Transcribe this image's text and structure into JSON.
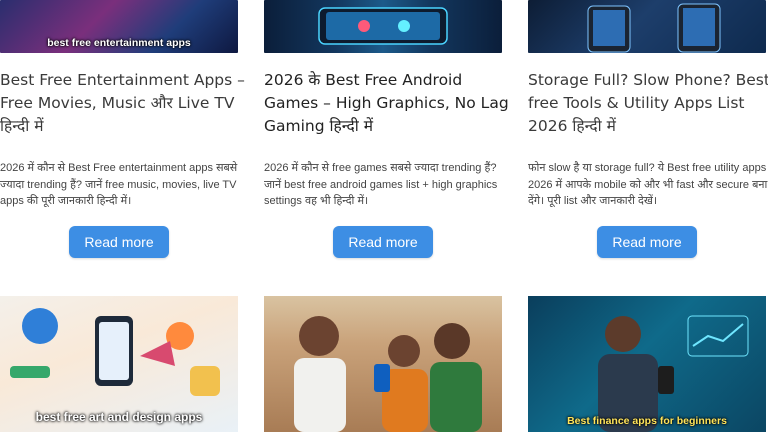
{
  "cards": [
    {
      "image_caption": "best free entertainment apps",
      "title": "Best Free Entertainment Apps – Free Movies, Music और Live TV हिन्दी में",
      "excerpt": "2026 में कौन से Best Free entertainment apps सबसे ज्यादा trending हैं? जानें free music, movies, live TV apps की पूरी जानकारी हिन्दी में।",
      "button": "Read more"
    },
    {
      "image_caption": "",
      "title": "2026 के Best Free Android Games – High Graphics, No Lag Gaming हिन्दी में",
      "excerpt": "2026 में कौन से free games सबसे ज्यादा trending हैं? जानें best free android games list + high graphics settings वह भी हिन्दी में।",
      "button": "Read more"
    },
    {
      "image_caption": "",
      "title": "Storage Full? Slow Phone? Best free Tools & Utility Apps List 2026 हिन्दी में",
      "excerpt": "फोन slow है या storage full? ये Best free utility apps 2026 में आपके mobile को और भी fast और secure बना देंगे। पूरी list और जानकारी देखें।",
      "button": "Read more"
    }
  ],
  "bottom_cards": [
    {
      "image_caption": "best free art and design apps"
    },
    {
      "image_caption": ""
    },
    {
      "image_caption": "Best finance apps for beginners"
    }
  ]
}
